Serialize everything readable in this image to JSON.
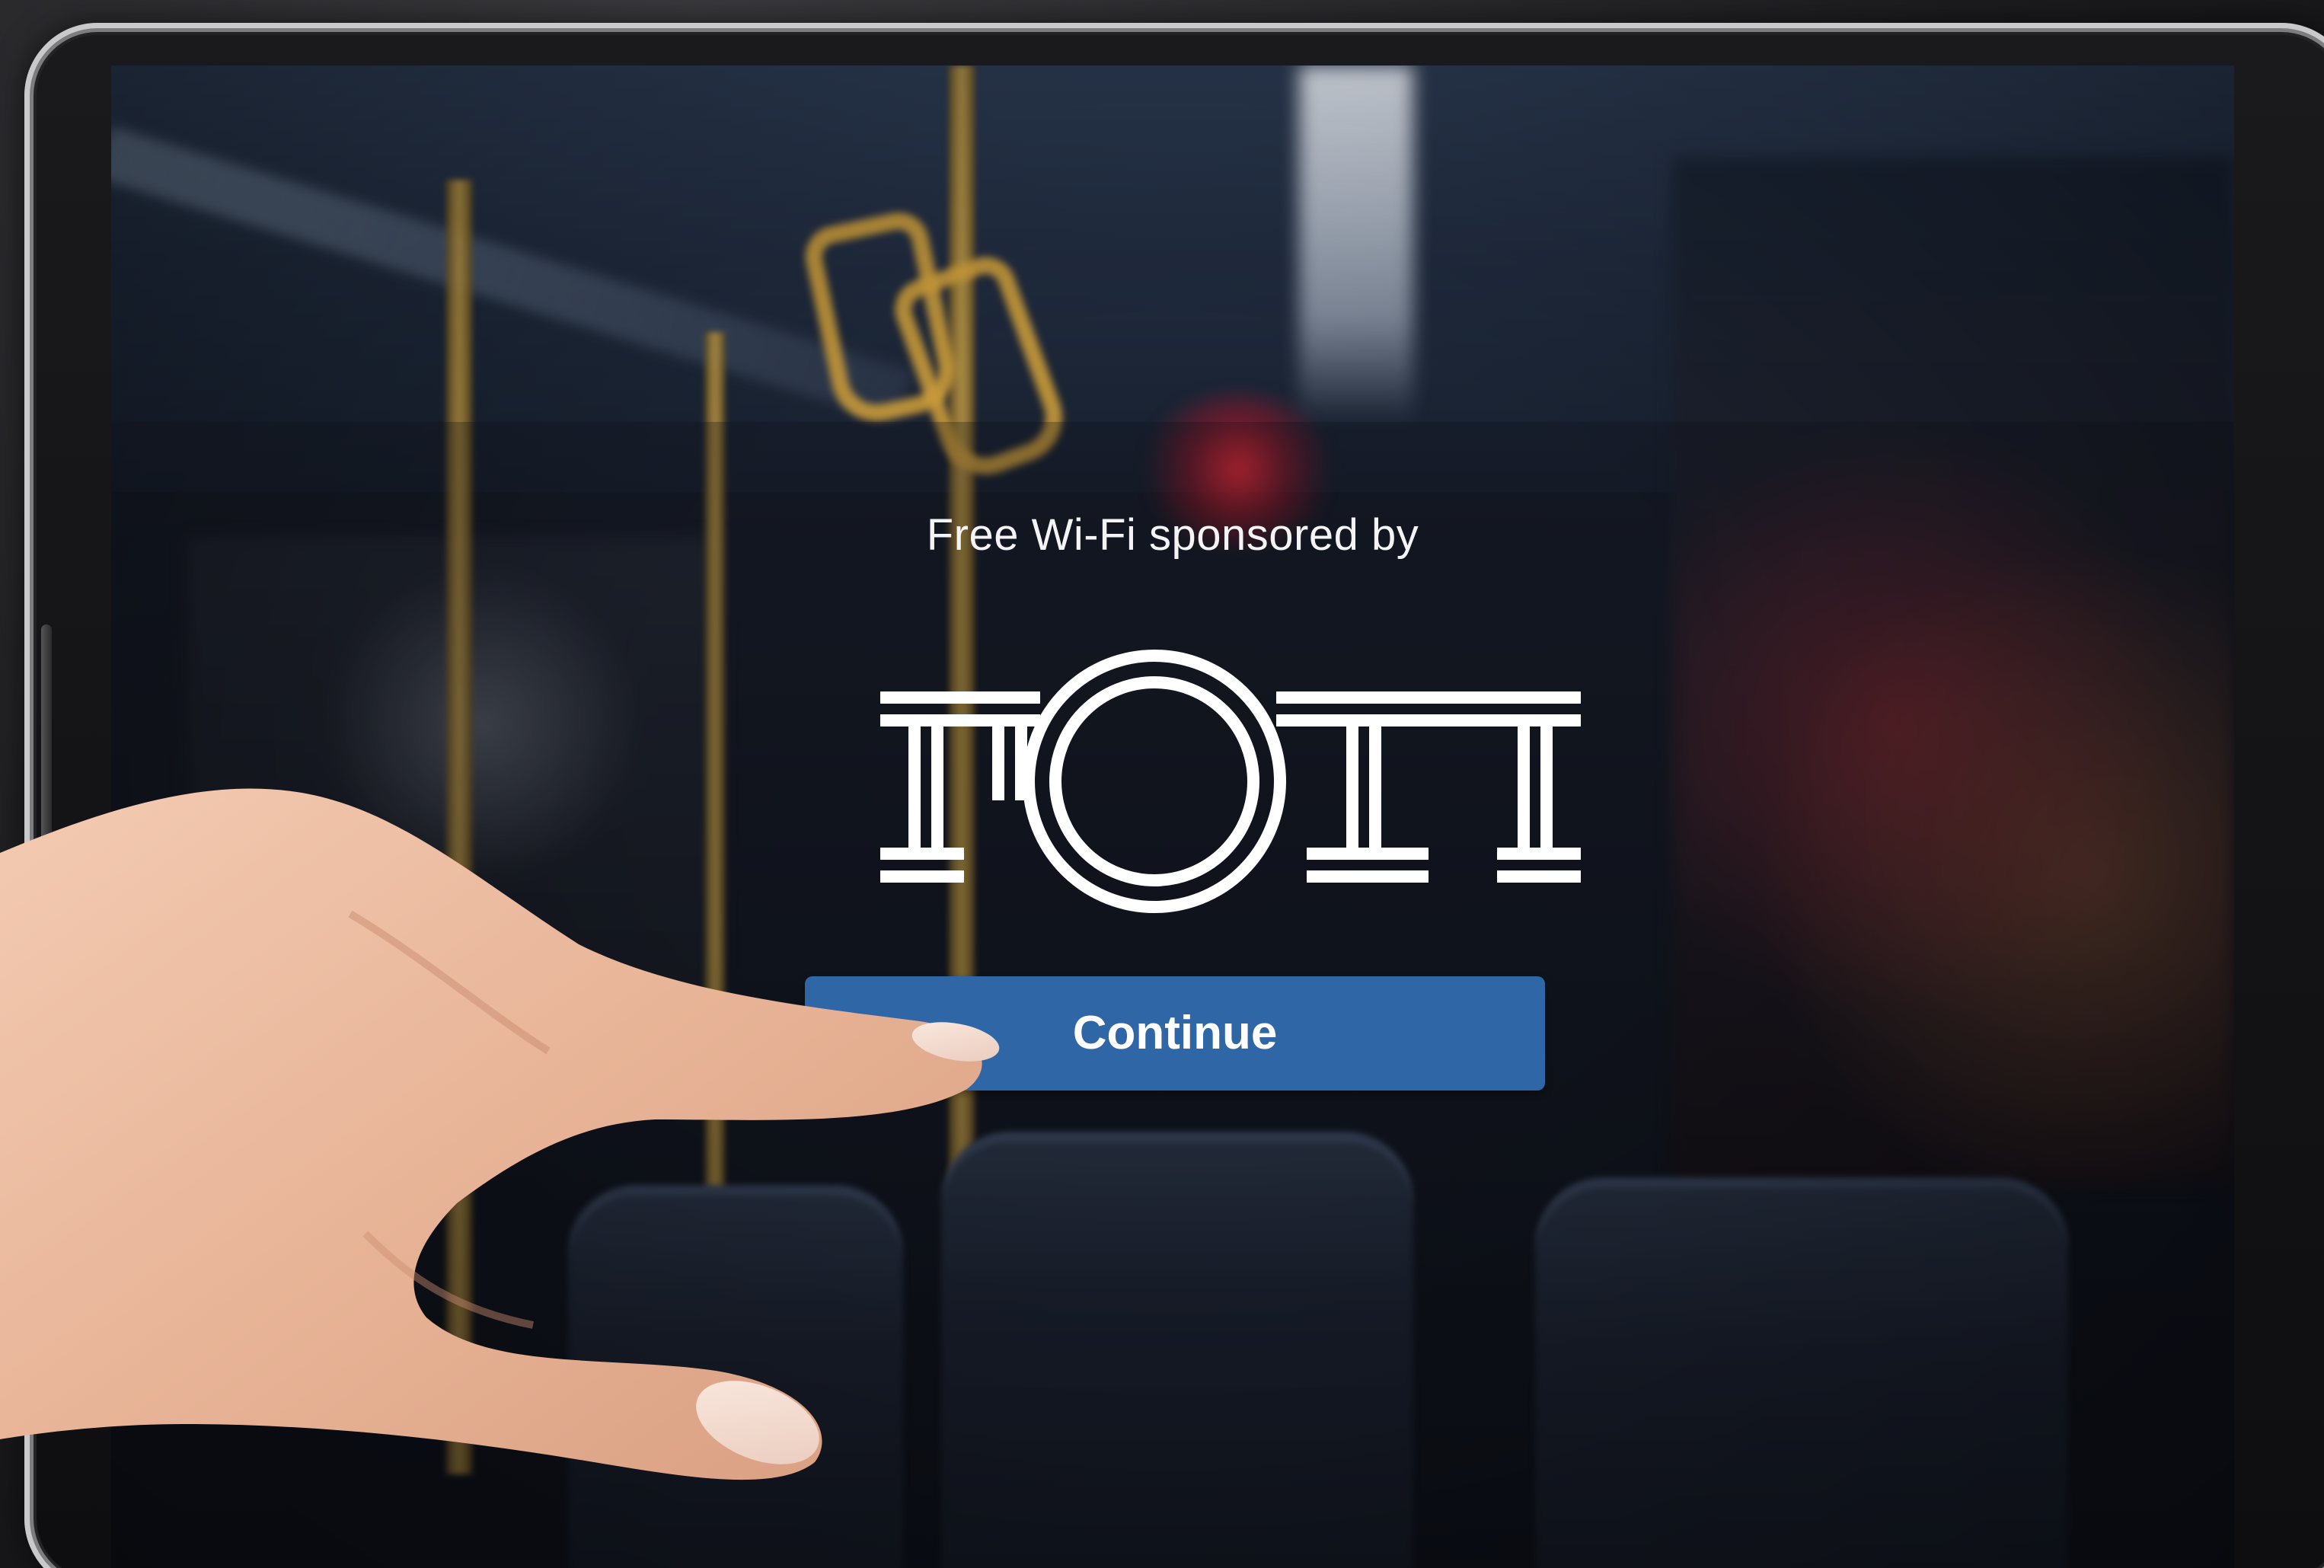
{
  "portal": {
    "sponsor_text": "Free Wi-Fi sponsored by",
    "logo_name": "roc-logo",
    "continue_label": "Continue",
    "button_color": "#2f66a6",
    "text_color": "#ffffff"
  },
  "scene": {
    "device": "tablet",
    "background": "blurred bus interior",
    "overlay": "hand pointing at continue button"
  }
}
